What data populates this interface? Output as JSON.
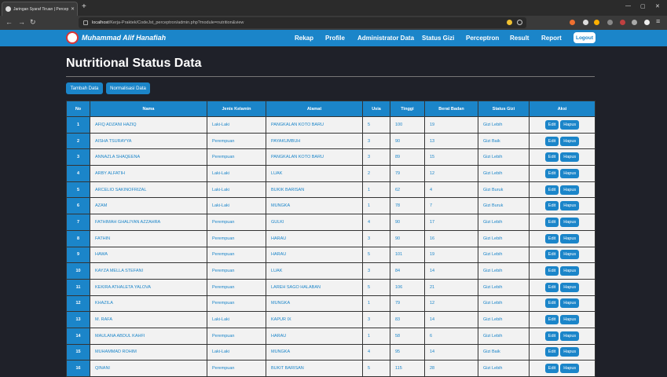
{
  "browser": {
    "tab_title": "Jaringan Syaraf Tiruan | Perceptron",
    "url_host": "localhost",
    "url_path": "/Kerja-Praktek/CodeJst_perceptron/admin.php?module=nutrition&view"
  },
  "nav": {
    "brand": "Muhammad Alif Hanafiah",
    "items": [
      "Rekap",
      "Profile",
      "Administrator Data",
      "Status Gizi",
      "Perceptron",
      "Result",
      "Report"
    ],
    "logout": "Logout"
  },
  "page": {
    "title": "Nutritional Status Data",
    "btn_add": "Tambah Data",
    "btn_normalize": "Normalisasi Data"
  },
  "table": {
    "headers": [
      "No",
      "Nama",
      "Jenis Kelamin",
      "Alamat",
      "Usia",
      "Tinggi",
      "Berat Badan",
      "Status Gizi",
      "Aksi"
    ],
    "edit_label": "Edit",
    "delete_label": "Hapus",
    "rows": [
      [
        "1",
        "AFIQ ADZANI HAZIQ",
        "Laki-Laki",
        "PANGKALAN KOTO BARU",
        "5",
        "100",
        "19",
        "Gizi Lebih"
      ],
      [
        "2",
        "AISHA TSURAYYA",
        "Perempuan",
        "PAYAKUMBUH",
        "3",
        "90",
        "13",
        "Gizi Baik"
      ],
      [
        "3",
        "ANNAZLA SHAQEENA",
        "Perempuan",
        "PANGKALAN KOTO BARU",
        "3",
        "89",
        "15",
        "Gizi Lebih"
      ],
      [
        "4",
        "ARBY ALFATIH",
        "Laki-Laki",
        "LUAK",
        "2",
        "79",
        "12",
        "Gizi Lebih"
      ],
      [
        "5",
        "ARCELIO SAKINOFRIZAL",
        "Laki-Laki",
        "BUKIK BARISAN",
        "1",
        "62",
        "4",
        "Gizi Buruk"
      ],
      [
        "6",
        "AZAM",
        "Laki-Laki",
        "MUNGKA",
        "1",
        "78",
        "7",
        "Gizi Buruk"
      ],
      [
        "7",
        "FATHIMAH GHALIYAN AZZAHRA",
        "Perempuan",
        "GULKI",
        "4",
        "90",
        "17",
        "Gizi Lebih"
      ],
      [
        "8",
        "FATHIN",
        "Perempuan",
        "HARAU",
        "3",
        "90",
        "16",
        "Gizi Lebih"
      ],
      [
        "9",
        "HAWA",
        "Perempuan",
        "HARAU",
        "5",
        "101",
        "19",
        "Gizi Lebih"
      ],
      [
        "10",
        "KAYZA MELLA STEFANI",
        "Perempuan",
        "LUAK",
        "3",
        "84",
        "14",
        "Gizi Lebih"
      ],
      [
        "11",
        "KEKIRA ATHALETA YALOVA",
        "Perempuan",
        "LAREH SAGO HALABAN",
        "5",
        "106",
        "21",
        "Gizi Lebih"
      ],
      [
        "12",
        "KHAZILA",
        "Perempuan",
        "MUNGKA",
        "1",
        "79",
        "12",
        "Gizi Lebih"
      ],
      [
        "13",
        "M. RAFA",
        "Laki-Laki",
        "KAPUR IX",
        "3",
        "83",
        "14",
        "Gizi Lebih"
      ],
      [
        "14",
        "MAULANA ABDUL KAHFI",
        "Perempuan",
        "HARAU",
        "1",
        "58",
        "6",
        "Gizi Lebih"
      ],
      [
        "15",
        "MUHAMMAD ROHIM",
        "Laki-Laki",
        "MUNGKA",
        "4",
        "95",
        "14",
        "Gizi Baik"
      ],
      [
        "16",
        "QINANI",
        "Perempuan",
        "BUKIT BARISAN",
        "5",
        "115",
        "28",
        "Gizi Lebih"
      ]
    ]
  },
  "colors": {
    "accent": "#1b85c9",
    "bg": "#1f2129"
  }
}
